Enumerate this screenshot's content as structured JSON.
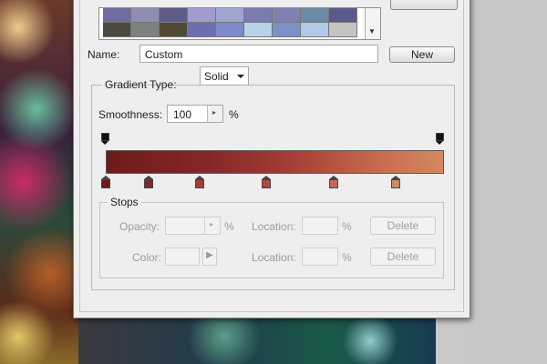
{
  "dialog": {
    "name_label": "Name:",
    "name_value": "Custom",
    "new_button": "New",
    "presets": {
      "colors": [
        [
          "#6e6ca0",
          "#8e8eb2",
          "#5d5c84",
          "#a19bd0",
          "#9ea6d0",
          "#7b7bb1",
          "#7f80b0",
          "#6a8aa6",
          "#5a5a8a"
        ],
        [
          "#4a4a3f",
          "#7f8080",
          "#504a35",
          "#6c6fae",
          "#7f88c8",
          "#b7d1e8",
          "#7d90c8",
          "#b1c8e6",
          "#c4c4c4"
        ]
      ]
    },
    "gradient_type_label": "Gradient Type:",
    "gradient_type_value": "Solid",
    "smoothness_label": "Smoothness:",
    "smoothness_value": "100",
    "smoothness_unit": "%",
    "gradient": {
      "color_stops": [
        "#6e1a1b",
        "#852728",
        "#a53d35",
        "#b5493c",
        "#c8694f",
        "#d3895e"
      ]
    },
    "stops": {
      "legend": "Stops",
      "opacity_label": "Opacity:",
      "opacity_unit": "%",
      "location_label": "Location:",
      "location_unit": "%",
      "color_label": "Color:",
      "delete_button": "Delete"
    }
  }
}
